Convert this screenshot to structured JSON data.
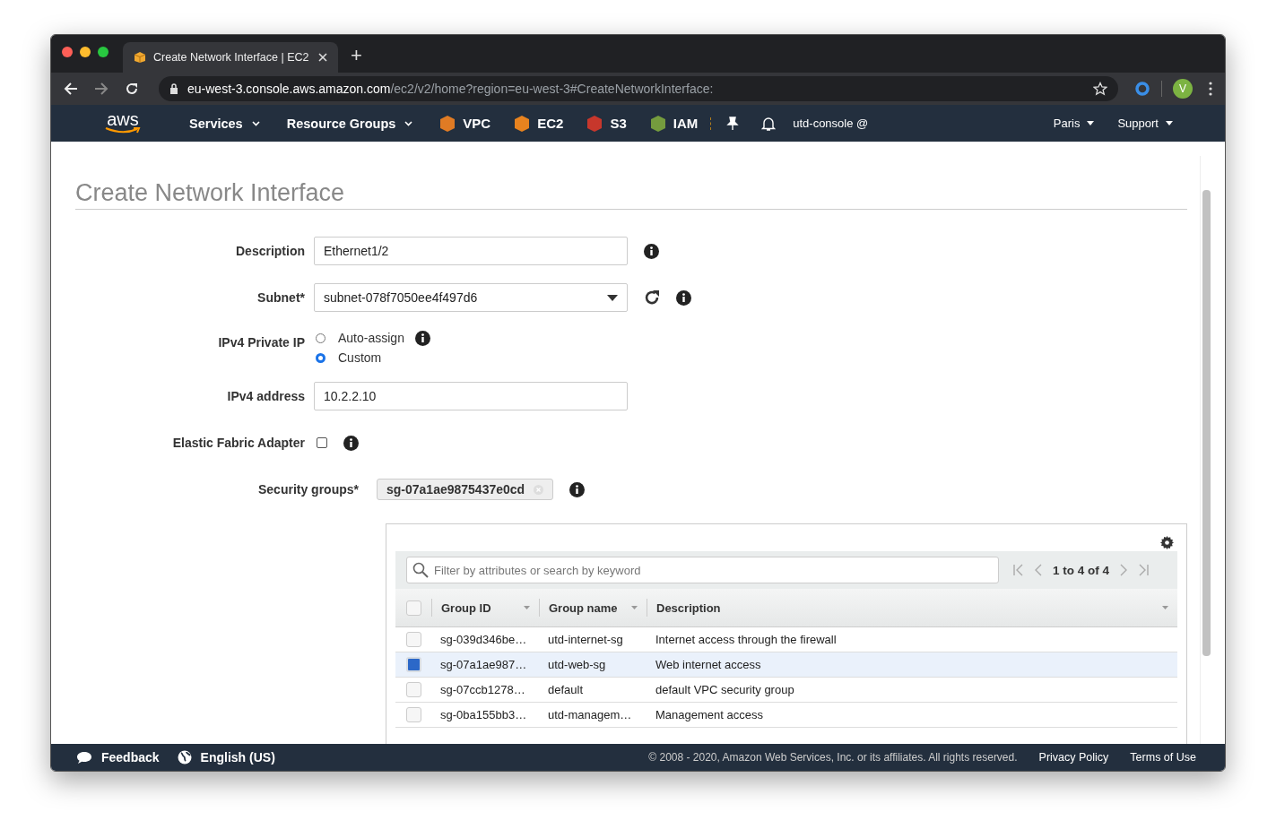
{
  "browser": {
    "tab_title": "Create Network Interface | EC2",
    "new_tab": "+",
    "url_host": "eu-west-3.console.aws.amazon.com",
    "url_path": "/ec2/v2/home?region=eu-west-3#CreateNetworkInterface:",
    "avatar": "V"
  },
  "nav": {
    "logo": "aws",
    "menus": [
      "Services",
      "Resource Groups"
    ],
    "shortcuts": [
      {
        "label": "VPC",
        "color": "#e07b24"
      },
      {
        "label": "EC2",
        "color": "#e8831f"
      },
      {
        "label": "S3",
        "color": "#c7372c"
      },
      {
        "label": "IAM",
        "color": "#759c3e"
      }
    ],
    "account": "utd-console @",
    "region": "Paris",
    "support": "Support"
  },
  "page": {
    "title": "Create Network Interface"
  },
  "form": {
    "description": {
      "label": "Description",
      "value": "Ethernet1/2"
    },
    "subnet": {
      "label": "Subnet*",
      "value": "subnet-078f7050ee4f497d6"
    },
    "private_ip": {
      "label": "IPv4 Private IP",
      "options": [
        {
          "label": "Auto-assign",
          "selected": false
        },
        {
          "label": "Custom",
          "selected": true
        }
      ]
    },
    "ipv4": {
      "label": "IPv4 address",
      "value": "10.2.2.10"
    },
    "efa": {
      "label": "Elastic Fabric Adapter",
      "checked": false
    },
    "security_groups": {
      "label": "Security groups*",
      "tokens": [
        "sg-07a1ae9875437e0cd"
      ]
    }
  },
  "table": {
    "filter_placeholder": "Filter by attributes or search by keyword",
    "pagination": "1 to 4 of 4",
    "select_all": {
      "checked": false
    },
    "columns": [
      "Group ID",
      "Group name",
      "Description"
    ],
    "rows": [
      {
        "cells": [
          "sg-039d346be…",
          "utd-internet-sg",
          "Internet access through the firewall"
        ],
        "selected": false
      },
      {
        "cells": [
          "sg-07a1ae987…",
          "utd-web-sg",
          "Web internet access"
        ],
        "selected": true
      },
      {
        "cells": [
          "sg-07ccb1278…",
          "default",
          "default VPC security group"
        ],
        "selected": false
      },
      {
        "cells": [
          "sg-0ba155bb3…",
          "utd-managem…",
          "Management access"
        ],
        "selected": false
      }
    ]
  },
  "footer": {
    "feedback": "Feedback",
    "language": "English (US)",
    "copyright": "© 2008 - 2020, Amazon Web Services, Inc. or its affiliates. All rights reserved.",
    "links": [
      "Privacy Policy",
      "Terms of Use"
    ]
  }
}
